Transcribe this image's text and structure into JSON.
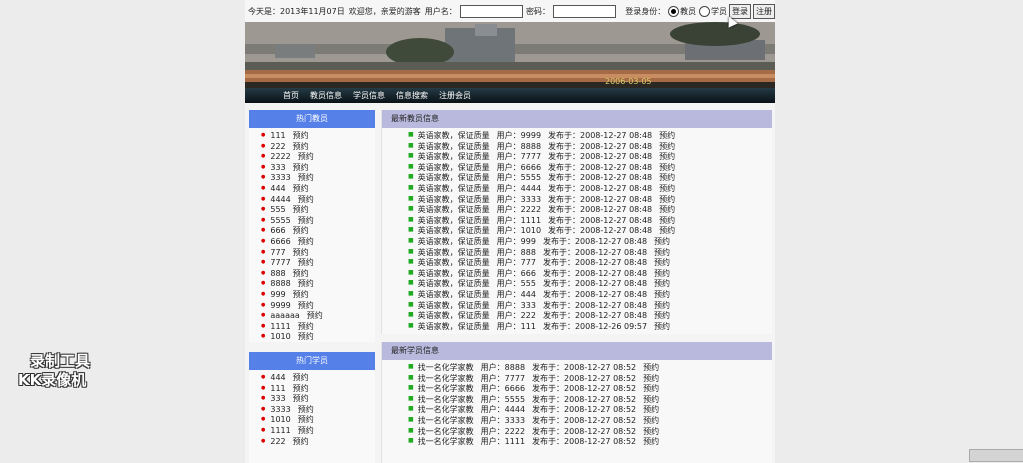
{
  "topbar": {
    "today_label": "今天是：2013年11月07日",
    "welcome": "欢迎您，亲爱的游客",
    "username_label": "用户名：",
    "username_value": "",
    "password_label": "密码：",
    "password_value": "",
    "role_label": "登录身份：",
    "role_teacher": "教员",
    "role_student": "学员",
    "selected_role": "教员",
    "login_label": "登录",
    "register_label": "注册"
  },
  "banner": {
    "date_text": "2006-03-05"
  },
  "nav": {
    "items": [
      "首页",
      "教员信息",
      "学员信息",
      "信息搜索",
      "注册会员"
    ]
  },
  "hot_teachers": {
    "title": "热门教员",
    "items": [
      {
        "name": "111",
        "action": "预约"
      },
      {
        "name": "222",
        "action": "预约"
      },
      {
        "name": "2222",
        "action": "预约"
      },
      {
        "name": "333",
        "action": "预约"
      },
      {
        "name": "3333",
        "action": "预约"
      },
      {
        "name": "444",
        "action": "预约"
      },
      {
        "name": "4444",
        "action": "预约"
      },
      {
        "name": "555",
        "action": "预约"
      },
      {
        "name": "5555",
        "action": "预约"
      },
      {
        "name": "666",
        "action": "预约"
      },
      {
        "name": "6666",
        "action": "预约"
      },
      {
        "name": "777",
        "action": "预约"
      },
      {
        "name": "7777",
        "action": "预约"
      },
      {
        "name": "888",
        "action": "预约"
      },
      {
        "name": "8888",
        "action": "预约"
      },
      {
        "name": "999",
        "action": "预约"
      },
      {
        "name": "9999",
        "action": "预约"
      },
      {
        "name": "aaaaaa",
        "action": "预约"
      },
      {
        "name": "1111",
        "action": "预约"
      },
      {
        "name": "1010",
        "action": "预约"
      }
    ]
  },
  "hot_students": {
    "title": "热门学员",
    "items": [
      {
        "name": "444",
        "action": "预约"
      },
      {
        "name": "111",
        "action": "预约"
      },
      {
        "name": "333",
        "action": "预约"
      },
      {
        "name": "3333",
        "action": "预约"
      },
      {
        "name": "1010",
        "action": "预约"
      },
      {
        "name": "1111",
        "action": "预约"
      },
      {
        "name": "222",
        "action": "预约"
      }
    ]
  },
  "latest_teachers": {
    "title": "最新教员信息",
    "items": [
      {
        "title": "英语家教，保证质量",
        "user": "用户：9999",
        "date": "发布于：2008-12-27 08:48",
        "action": "预约"
      },
      {
        "title": "英语家教，保证质量",
        "user": "用户：8888",
        "date": "发布于：2008-12-27 08:48",
        "action": "预约"
      },
      {
        "title": "英语家教，保证质量",
        "user": "用户：7777",
        "date": "发布于：2008-12-27 08:48",
        "action": "预约"
      },
      {
        "title": "英语家教，保证质量",
        "user": "用户：6666",
        "date": "发布于：2008-12-27 08:48",
        "action": "预约"
      },
      {
        "title": "英语家教，保证质量",
        "user": "用户：5555",
        "date": "发布于：2008-12-27 08:48",
        "action": "预约"
      },
      {
        "title": "英语家教，保证质量",
        "user": "用户：4444",
        "date": "发布于：2008-12-27 08:48",
        "action": "预约"
      },
      {
        "title": "英语家教，保证质量",
        "user": "用户：3333",
        "date": "发布于：2008-12-27 08:48",
        "action": "预约"
      },
      {
        "title": "英语家教，保证质量",
        "user": "用户：2222",
        "date": "发布于：2008-12-27 08:48",
        "action": "预约"
      },
      {
        "title": "英语家教，保证质量",
        "user": "用户：1111",
        "date": "发布于：2008-12-27 08:48",
        "action": "预约"
      },
      {
        "title": "英语家教，保证质量",
        "user": "用户：1010",
        "date": "发布于：2008-12-27 08:48",
        "action": "预约"
      },
      {
        "title": "英语家教，保证质量",
        "user": "用户：999",
        "date": "发布于：2008-12-27 08:48",
        "action": "预约"
      },
      {
        "title": "英语家教，保证质量",
        "user": "用户：888",
        "date": "发布于：2008-12-27 08:48",
        "action": "预约"
      },
      {
        "title": "英语家教，保证质量",
        "user": "用户：777",
        "date": "发布于：2008-12-27 08:48",
        "action": "预约"
      },
      {
        "title": "英语家教，保证质量",
        "user": "用户：666",
        "date": "发布于：2008-12-27 08:48",
        "action": "预约"
      },
      {
        "title": "英语家教，保证质量",
        "user": "用户：555",
        "date": "发布于：2008-12-27 08:48",
        "action": "预约"
      },
      {
        "title": "英语家教，保证质量",
        "user": "用户：444",
        "date": "发布于：2008-12-27 08:48",
        "action": "预约"
      },
      {
        "title": "英语家教，保证质量",
        "user": "用户：333",
        "date": "发布于：2008-12-27 08:48",
        "action": "预约"
      },
      {
        "title": "英语家教，保证质量",
        "user": "用户：222",
        "date": "发布于：2008-12-27 08:48",
        "action": "预约"
      },
      {
        "title": "英语家教，保证质量",
        "user": "用户：111",
        "date": "发布于：2008-12-26 09:57",
        "action": "预约"
      }
    ]
  },
  "latest_students": {
    "title": "最新学员信息",
    "items": [
      {
        "title": "找一名化学家教",
        "user": "用户：8888",
        "date": "发布于：2008-12-27 08:52",
        "action": "预约"
      },
      {
        "title": "找一名化学家教",
        "user": "用户：7777",
        "date": "发布于：2008-12-27 08:52",
        "action": "预约"
      },
      {
        "title": "找一名化学家教",
        "user": "用户：6666",
        "date": "发布于：2008-12-27 08:52",
        "action": "预约"
      },
      {
        "title": "找一名化学家教",
        "user": "用户：5555",
        "date": "发布于：2008-12-27 08:52",
        "action": "预约"
      },
      {
        "title": "找一名化学家教",
        "user": "用户：4444",
        "date": "发布于：2008-12-27 08:52",
        "action": "预约"
      },
      {
        "title": "找一名化学家教",
        "user": "用户：3333",
        "date": "发布于：2008-12-27 08:52",
        "action": "预约"
      },
      {
        "title": "找一名化学家教",
        "user": "用户：2222",
        "date": "发布于：2008-12-27 08:52",
        "action": "预约"
      },
      {
        "title": "找一名化学家教",
        "user": "用户：1111",
        "date": "发布于：2008-12-27 08:52",
        "action": "预约"
      }
    ]
  },
  "watermark": {
    "line1": "录制工具",
    "line2": "KK录像机"
  },
  "colors": {
    "side_header": "#5580e8",
    "panel_header": "#b9b9de",
    "bullet_red": "#dd0000",
    "bullet_green": "#22aa22"
  }
}
